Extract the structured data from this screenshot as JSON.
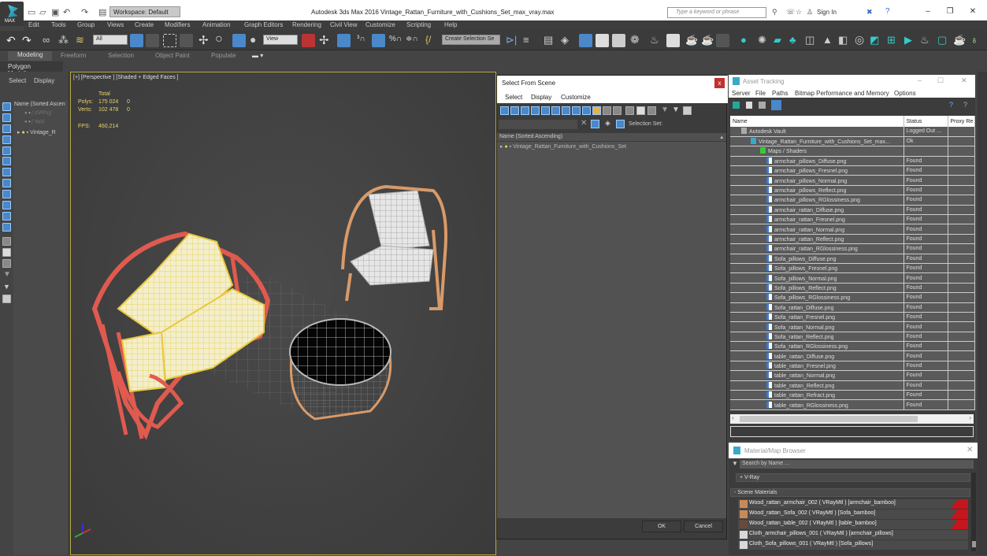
{
  "titlebar": {
    "logo_text": "MAX",
    "workspace": "Workspace: Default",
    "title": "Autodesk 3ds Max 2016    Vintage_Rattan_Furniture_with_Cushions_Set_max_vray.max",
    "search_placeholder": "Type a keyword or phrase",
    "sign_in": "Sign In",
    "minimize": "–",
    "restore": "❐",
    "close": "✕"
  },
  "menu": [
    "Edit",
    "Tools",
    "Group",
    "Views",
    "Create",
    "Modifiers",
    "Animation",
    "Graph Editors",
    "Rendering",
    "Civil View",
    "Customize",
    "Scripting",
    "Help"
  ],
  "toolbar": {
    "selection_filter": "All",
    "ref_coord": "View",
    "named_selection": "Create Selection Se"
  },
  "ribbon": {
    "tabs": [
      "Modeling",
      "Freeform",
      "Selection",
      "Object Paint",
      "Populate"
    ],
    "active": "Modeling",
    "sub_label": "Polygon Modeling"
  },
  "left_panel": {
    "tabs": [
      "Select",
      "Display"
    ],
    "column_header": "Name (Sorted Ascen",
    "items": [
      "[ (GRPs)]",
      "[ objs]",
      "Vintage_R"
    ]
  },
  "viewport": {
    "label": "[+] [Perspective ] [Shaded + Edged Faces ]",
    "stats_header": "Total",
    "polys_label": "Polys:",
    "polys_value": "175 024",
    "polys_sel": "0",
    "verts_label": "Verts:",
    "verts_value": "102 478",
    "verts_sel": "0",
    "fps_label": "FPS:",
    "fps_value": "460,214"
  },
  "select_from_scene": {
    "title": "Select From Scene",
    "close": "x",
    "menu": [
      "Select",
      "Display",
      "Customize"
    ],
    "selection_set_label": "Selection Set:",
    "column_header": "Name (Sorted Ascending)",
    "items": [
      "Vintage_Rattan_Furniture_with_Cushions_Set"
    ],
    "ok": "OK",
    "cancel": "Cancel"
  },
  "asset_tracking": {
    "title": "Asset Tracking",
    "menu": [
      "Server",
      "File",
      "Paths",
      "Bitmap Performance and Memory",
      "Options"
    ],
    "columns": [
      "Name",
      "Status",
      "Proxy Re"
    ],
    "rows": [
      {
        "name": "Autodesk Vault",
        "status": "Logged Out ...",
        "level": 1
      },
      {
        "name": "Vintage_Rattan_Furniture_with_Cushions_Set_max...",
        "status": "Ok",
        "level": 2
      },
      {
        "name": "Maps / Shaders",
        "status": "",
        "level": 3
      },
      {
        "name": "armchair_pillows_Diffuse.png",
        "status": "Found",
        "level": 4
      },
      {
        "name": "armchair_pillows_Fresnel.png",
        "status": "Found",
        "level": 4
      },
      {
        "name": "armchair_pillows_Normal.png",
        "status": "Found",
        "level": 4
      },
      {
        "name": "armchair_pillows_Reflect.png",
        "status": "Found",
        "level": 4
      },
      {
        "name": "armchair_pillows_RGlossiness.png",
        "status": "Found",
        "level": 4
      },
      {
        "name": "armchair_rattan_Diffuse.png",
        "status": "Found",
        "level": 4
      },
      {
        "name": "armchair_rattan_Fresnel.png",
        "status": "Found",
        "level": 4
      },
      {
        "name": "armchair_rattan_Normal.png",
        "status": "Found",
        "level": 4
      },
      {
        "name": "armchair_rattan_Reflect.png",
        "status": "Found",
        "level": 4
      },
      {
        "name": "armchair_rattan_RGlossiness.png",
        "status": "Found",
        "level": 4
      },
      {
        "name": "Sofa_pillows_Diffuse.png",
        "status": "Found",
        "level": 4
      },
      {
        "name": "Sofa_pillows_Fresnel.png",
        "status": "Found",
        "level": 4
      },
      {
        "name": "Sofa_pillows_Normal.png",
        "status": "Found",
        "level": 4
      },
      {
        "name": "Sofa_pillows_Reflect.png",
        "status": "Found",
        "level": 4
      },
      {
        "name": "Sofa_pillows_RGlossiness.png",
        "status": "Found",
        "level": 4
      },
      {
        "name": "Sofa_rattan_Diffuse.png",
        "status": "Found",
        "level": 4
      },
      {
        "name": "Sofa_rattan_Fresnel.png",
        "status": "Found",
        "level": 4
      },
      {
        "name": "Sofa_rattan_Normal.png",
        "status": "Found",
        "level": 4
      },
      {
        "name": "Sofa_rattan_Reflect.png",
        "status": "Found",
        "level": 4
      },
      {
        "name": "Sofa_rattan_RGlossiness.png",
        "status": "Found",
        "level": 4
      },
      {
        "name": "table_rattan_Diffuse.png",
        "status": "Found",
        "level": 4
      },
      {
        "name": "table_rattan_Fresnel.png",
        "status": "Found",
        "level": 4
      },
      {
        "name": "table_rattan_Normal.png",
        "status": "Found",
        "level": 4
      },
      {
        "name": "table_rattan_Reflect.png",
        "status": "Found",
        "level": 4
      },
      {
        "name": "table_rattan_Refract.png",
        "status": "Found",
        "level": 4
      },
      {
        "name": "table_rattan_RGlossiness.png",
        "status": "Found",
        "level": 4
      }
    ]
  },
  "material_browser": {
    "title": "Material/Map Browser",
    "search_placeholder": "Search by Name ...",
    "vray_section": "+ V-Ray",
    "scene_section": "- Scene Materials",
    "materials": [
      {
        "label": "Wood_rattan_armchair_002  ( VRayMtl )  [armchair_bamboo]",
        "swatch": "#c98a5a",
        "flag": true
      },
      {
        "label": "Wood_rattan_Sofa_002  ( VRayMtl )  [Sofa_bamboo]",
        "swatch": "#c98a5a",
        "flag": true
      },
      {
        "label": "Wood_rattan_table_002  ( VRayMtl )  [table_bamboo]",
        "swatch": "#6a4a3a",
        "flag": true
      },
      {
        "label": "Cloth_armchair_pillows_001  ( VRayMtl )  [armchair_pillows]",
        "swatch": "#d8d8d8",
        "flag": false
      },
      {
        "label": "Cloth_Sofa_pillows_001  ( VRayMtl )  [Sofa_pillows]",
        "swatch": "#d8d8d8",
        "flag": false
      }
    ]
  },
  "colors": {
    "accent_blue": "#4a88c9",
    "viewport_border": "#b6a840",
    "stats_yellow": "#e8d36b",
    "close_red": "#c4302b",
    "flag_red": "#c4161c"
  }
}
